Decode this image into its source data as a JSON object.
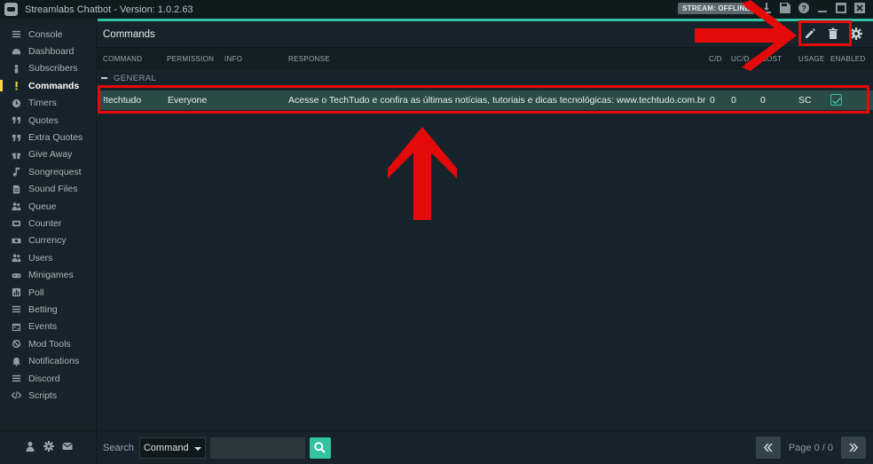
{
  "window": {
    "title": "Streamlabs Chatbot - Version: 1.0.2.63",
    "stream_status": "STREAM: OFFLINE"
  },
  "sidebar": {
    "items": [
      {
        "label": "Console",
        "icon": "list-icon"
      },
      {
        "label": "Dashboard",
        "icon": "dashboard-icon"
      },
      {
        "label": "Subscribers",
        "icon": "subscriber-icon"
      },
      {
        "label": "Commands",
        "icon": "exclamation-icon",
        "active": true
      },
      {
        "label": "Timers",
        "icon": "clock-icon"
      },
      {
        "label": "Quotes",
        "icon": "quote-icon"
      },
      {
        "label": "Extra Quotes",
        "icon": "quote-icon"
      },
      {
        "label": "Give Away",
        "icon": "gift-icon"
      },
      {
        "label": "Songrequest",
        "icon": "music-icon"
      },
      {
        "label": "Sound Files",
        "icon": "file-icon"
      },
      {
        "label": "Queue",
        "icon": "users-icon"
      },
      {
        "label": "Counter",
        "icon": "counter-icon"
      },
      {
        "label": "Currency",
        "icon": "currency-icon"
      },
      {
        "label": "Users",
        "icon": "users-icon"
      },
      {
        "label": "Minigames",
        "icon": "gamepad-icon"
      },
      {
        "label": "Poll",
        "icon": "poll-icon"
      },
      {
        "label": "Betting",
        "icon": "list-icon"
      },
      {
        "label": "Events",
        "icon": "calendar-icon"
      },
      {
        "label": "Mod Tools",
        "icon": "ban-icon"
      },
      {
        "label": "Notifications",
        "icon": "bell-icon"
      },
      {
        "label": "Discord",
        "icon": "list-icon"
      },
      {
        "label": "Scripts",
        "icon": "code-icon"
      }
    ]
  },
  "main": {
    "title": "Commands",
    "columns": [
      "COMMAND",
      "PERMISSION",
      "INFO",
      "RESPONSE",
      "C/D",
      "UC/D",
      "COST",
      "USAGE",
      "ENABLED"
    ],
    "group": "GENERAL",
    "rows": [
      {
        "command": "!techtudo",
        "permission": "Everyone",
        "info": "",
        "response": "Acesse o TechTudo e confira as últimas notícias, tutoriais e dicas tecnológicas: www.techtudo.com.br",
        "cd": "0",
        "ucd": "0",
        "cost": "0",
        "usage": "SC",
        "enabled": true
      }
    ]
  },
  "footer": {
    "search_label": "Search",
    "search_field": "Command",
    "search_value": "",
    "page_label": "Page 0 / 0"
  },
  "colors": {
    "accent": "#31c3a2",
    "active_nav": "#f7d74a",
    "selected_row": "#2a4b48",
    "annotation_red": "#e50a0a"
  }
}
